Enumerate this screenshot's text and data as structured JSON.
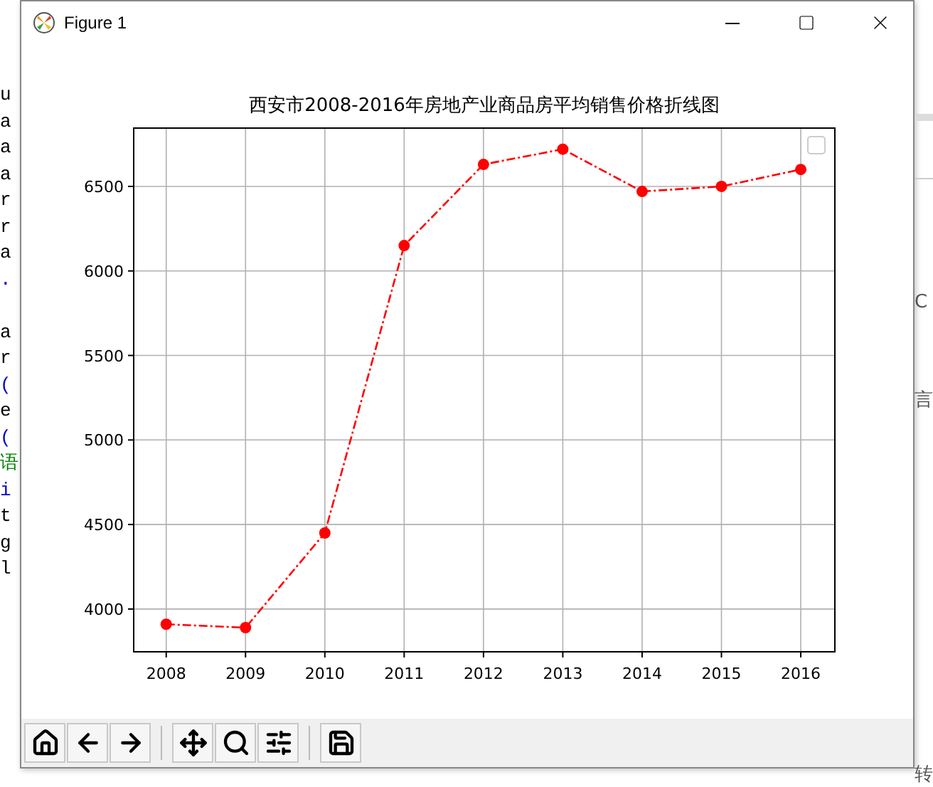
{
  "background_editor": {
    "left_groups": [
      [
        {
          "text": "u",
          "color": "#000000"
        },
        {
          "text": "a",
          "color": "#000000"
        },
        {
          "text": "a",
          "color": "#000000"
        },
        {
          "text": "a",
          "color": "#000000"
        },
        {
          "text": "r",
          "color": "#000000"
        },
        {
          "text": "r",
          "color": "#000000"
        },
        {
          "text": "a",
          "color": "#000000"
        },
        {
          "text": ".",
          "color": "#0000cc"
        }
      ],
      [
        {
          "text": "a",
          "color": "#000000"
        },
        {
          "text": "r",
          "color": "#000000"
        },
        {
          "text": "(",
          "color": "#0000cc"
        },
        {
          "text": "e",
          "color": "#000000"
        },
        {
          "text": "(",
          "color": "#0000cc"
        },
        {
          "text": "语",
          "color": "#008000"
        },
        {
          "text": "i",
          "color": "#0000cc"
        },
        {
          "text": "t",
          "color": "#000000"
        },
        {
          "text": "g",
          "color": "#000000"
        },
        {
          "text": "l",
          "color": "#000000"
        }
      ]
    ],
    "right_texts": [
      "C",
      "言",
      "转"
    ]
  },
  "window": {
    "title": "Figure 1"
  },
  "figure": {
    "legend": {
      "empty": true
    },
    "chart_data": {
      "type": "line",
      "title": "西安市2008-2016年房地产业商品房平均销售价格折线图",
      "x": [
        2008,
        2009,
        2010,
        2011,
        2012,
        2013,
        2014,
        2015,
        2016
      ],
      "series": [
        {
          "color": "#ff0000",
          "line_style": "dashdot",
          "marker": "circle",
          "values": [
            3910,
            3890,
            4450,
            6150,
            6630,
            6720,
            6470,
            6500,
            6600
          ]
        }
      ],
      "xlim": [
        2007.59,
        2016.43
      ],
      "ylim": [
        3747,
        6845
      ],
      "xticks": [
        2008,
        2009,
        2010,
        2011,
        2012,
        2013,
        2014,
        2015,
        2016
      ],
      "yticks": [
        4000,
        4500,
        5000,
        5500,
        6000,
        6500
      ],
      "grid": true
    }
  },
  "toolbar": {
    "groups": [
      [
        {
          "kind": "home"
        },
        {
          "kind": "back"
        },
        {
          "kind": "forward"
        }
      ],
      [
        {
          "kind": "pan"
        },
        {
          "kind": "zoom"
        },
        {
          "kind": "configure"
        }
      ],
      [
        {
          "kind": "save"
        }
      ]
    ]
  }
}
